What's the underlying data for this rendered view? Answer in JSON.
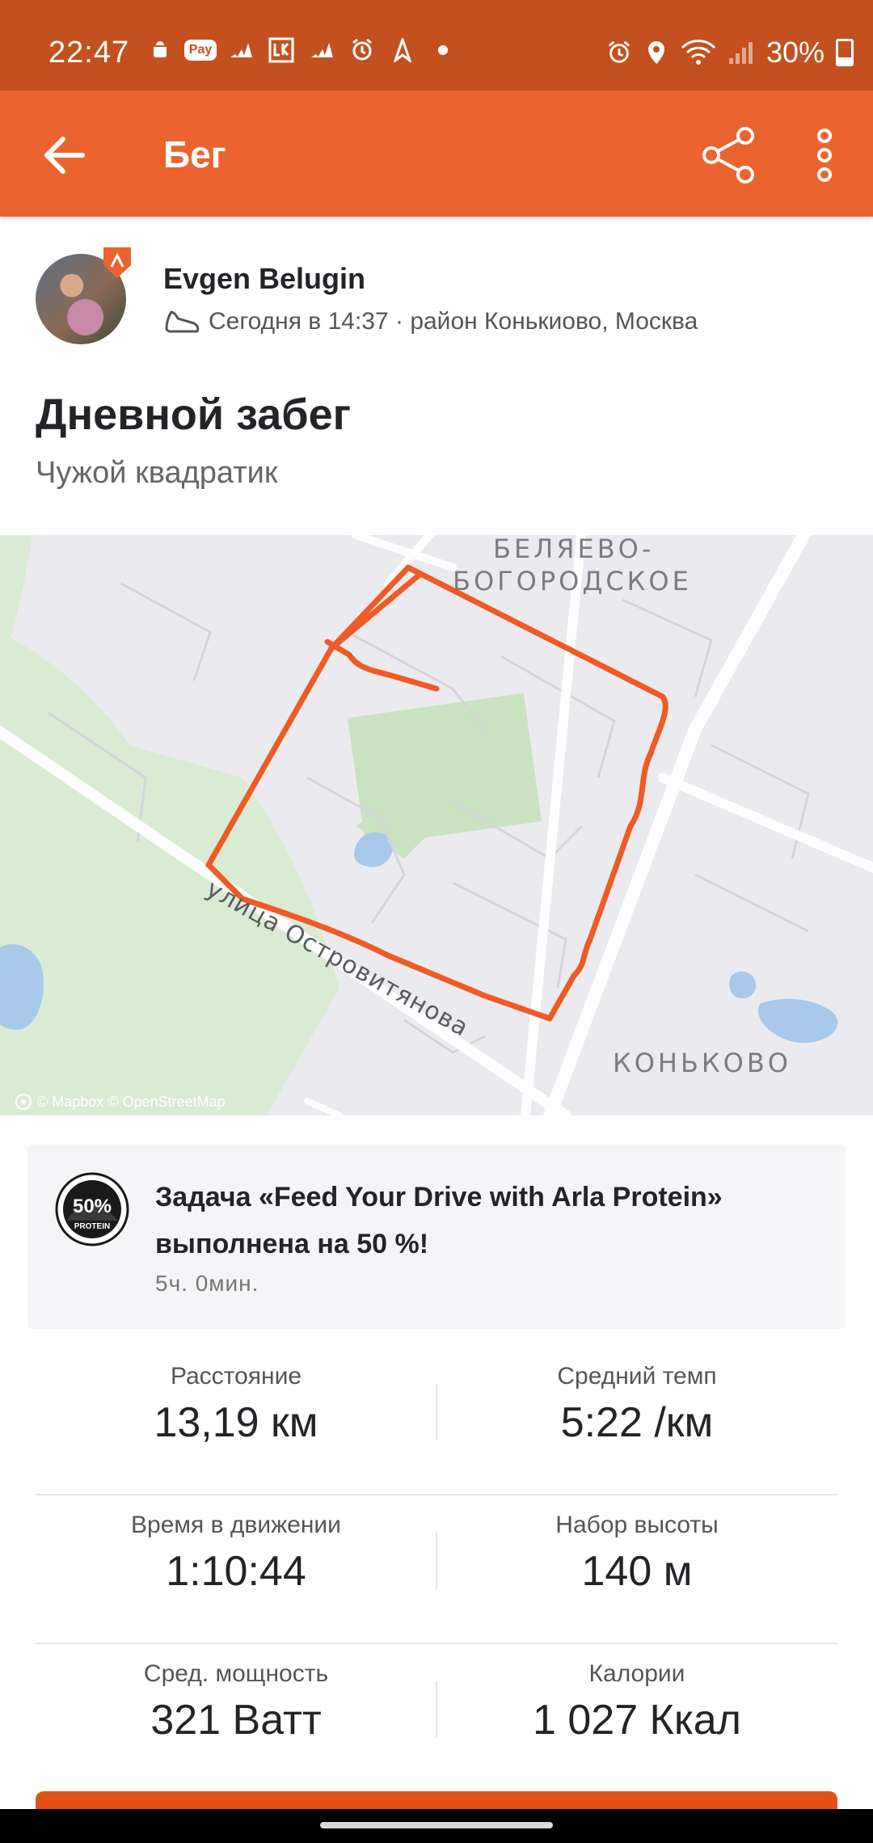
{
  "status_bar": {
    "time": "22:47",
    "battery": "30%",
    "battery_level": 0.3,
    "left_icons": [
      "android-icon",
      "pay-icon",
      "adidas-icon",
      "lukoil-icon",
      "adidas-icon",
      "alarm-icon",
      "navigation-icon",
      "dot-icon"
    ],
    "right_icons": [
      "alarm-icon",
      "location-icon",
      "wifi-icon",
      "signal-icon",
      "battery-icon"
    ],
    "pay_label": "Pay"
  },
  "app_bar": {
    "title": "Бег",
    "color": "#eb642f"
  },
  "athlete": {
    "name": "Evgen Belugin",
    "meta": "Сегодня в 14:37 · район Конькиово, Москва"
  },
  "activity": {
    "title": "Дневной забег",
    "description": "Чужой квадратик"
  },
  "map": {
    "labels": {
      "district_top_1": "БЕЛЯЕВО-",
      "district_top_2": "БОГОРОДСКОЕ",
      "street": "улица Островитянова",
      "district_bottom": "КОНЬКОВО"
    },
    "credit": "© Mapbox © OpenStreetMap",
    "route_color": "#f05a24"
  },
  "challenge": {
    "title": "Задача «Feed Your Drive with Arla Protein» выполнена на 50 %!",
    "time": "5ч. 0мин.",
    "badge_label": "50%",
    "badge_sublabel": "PROTEIN"
  },
  "stats": [
    {
      "label": "Расстояние",
      "value": "13,19 км"
    },
    {
      "label": "Средний темп",
      "value": "5:22 /км"
    },
    {
      "label": "Время в движении",
      "value": "1:10:44"
    },
    {
      "label": "Набор высоты",
      "value": "140 м"
    },
    {
      "label": "Сред. мощность",
      "value": "321 Ватт"
    },
    {
      "label": "Калории",
      "value": "1 027 Ккал"
    }
  ]
}
